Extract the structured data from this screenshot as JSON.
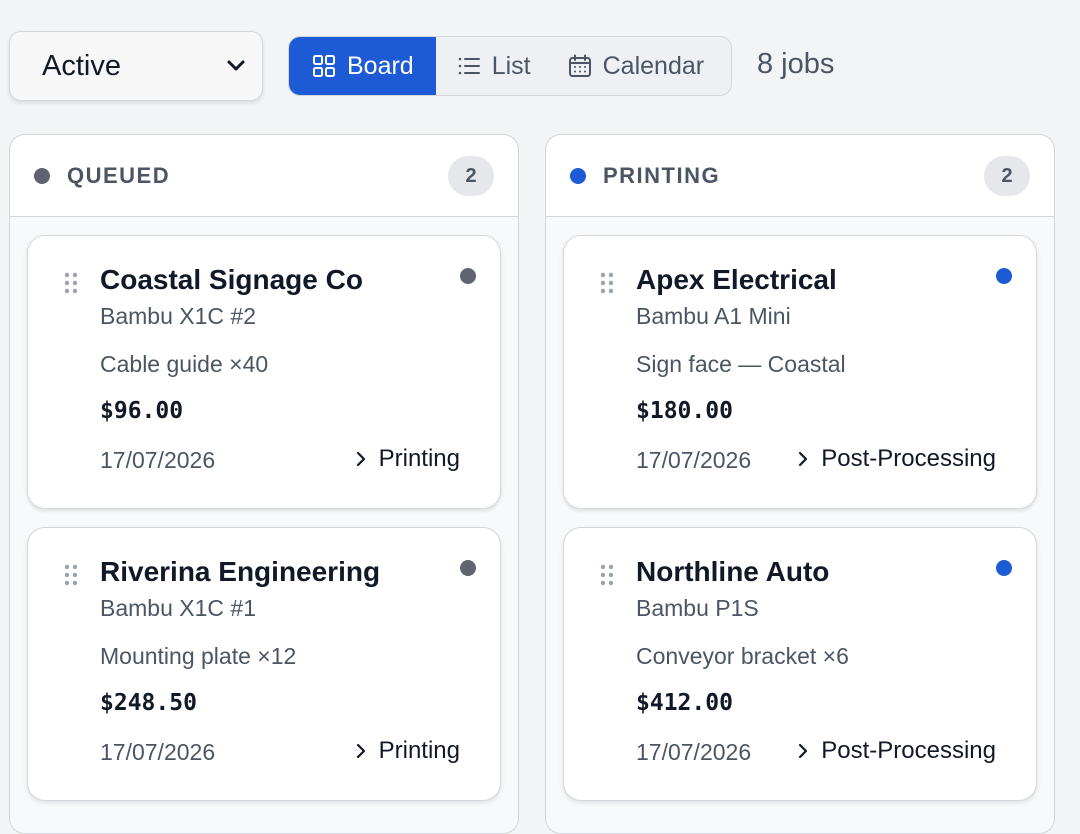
{
  "filter": {
    "selected": "Active"
  },
  "views": [
    {
      "label": "Board",
      "icon": "grid-icon",
      "active": true
    },
    {
      "label": "List",
      "icon": "list-icon",
      "active": false
    },
    {
      "label": "Calendar",
      "icon": "calendar-icon",
      "active": false
    }
  ],
  "job_count": "8 jobs",
  "colors": {
    "accent": "#1d5bd6",
    "queued": "#5f6470",
    "printing": "#1d5bd6"
  },
  "columns": [
    {
      "title": "QUEUED",
      "count": "2",
      "cards": [
        {
          "client": "Coastal Signage Co",
          "printer": "Bambu X1C #2",
          "item": "Cable guide ×40",
          "price": "$96.00",
          "date": "17/07/2026",
          "next_stage": "Printing"
        },
        {
          "client": "Riverina Engineering",
          "printer": "Bambu X1C #1",
          "item": "Mounting plate ×12",
          "price": "$248.50",
          "date": "17/07/2026",
          "next_stage": "Printing"
        }
      ]
    },
    {
      "title": "PRINTING",
      "count": "2",
      "cards": [
        {
          "client": "Apex Electrical",
          "printer": "Bambu A1 Mini",
          "item": "Sign face — Coastal",
          "price": "$180.00",
          "date": "17/07/2026",
          "next_stage": "Post-Processing"
        },
        {
          "client": "Northline Auto",
          "printer": "Bambu P1S",
          "item": "Conveyor bracket ×6",
          "price": "$412.00",
          "date": "17/07/2026",
          "next_stage": "Post-Processing"
        }
      ]
    }
  ]
}
